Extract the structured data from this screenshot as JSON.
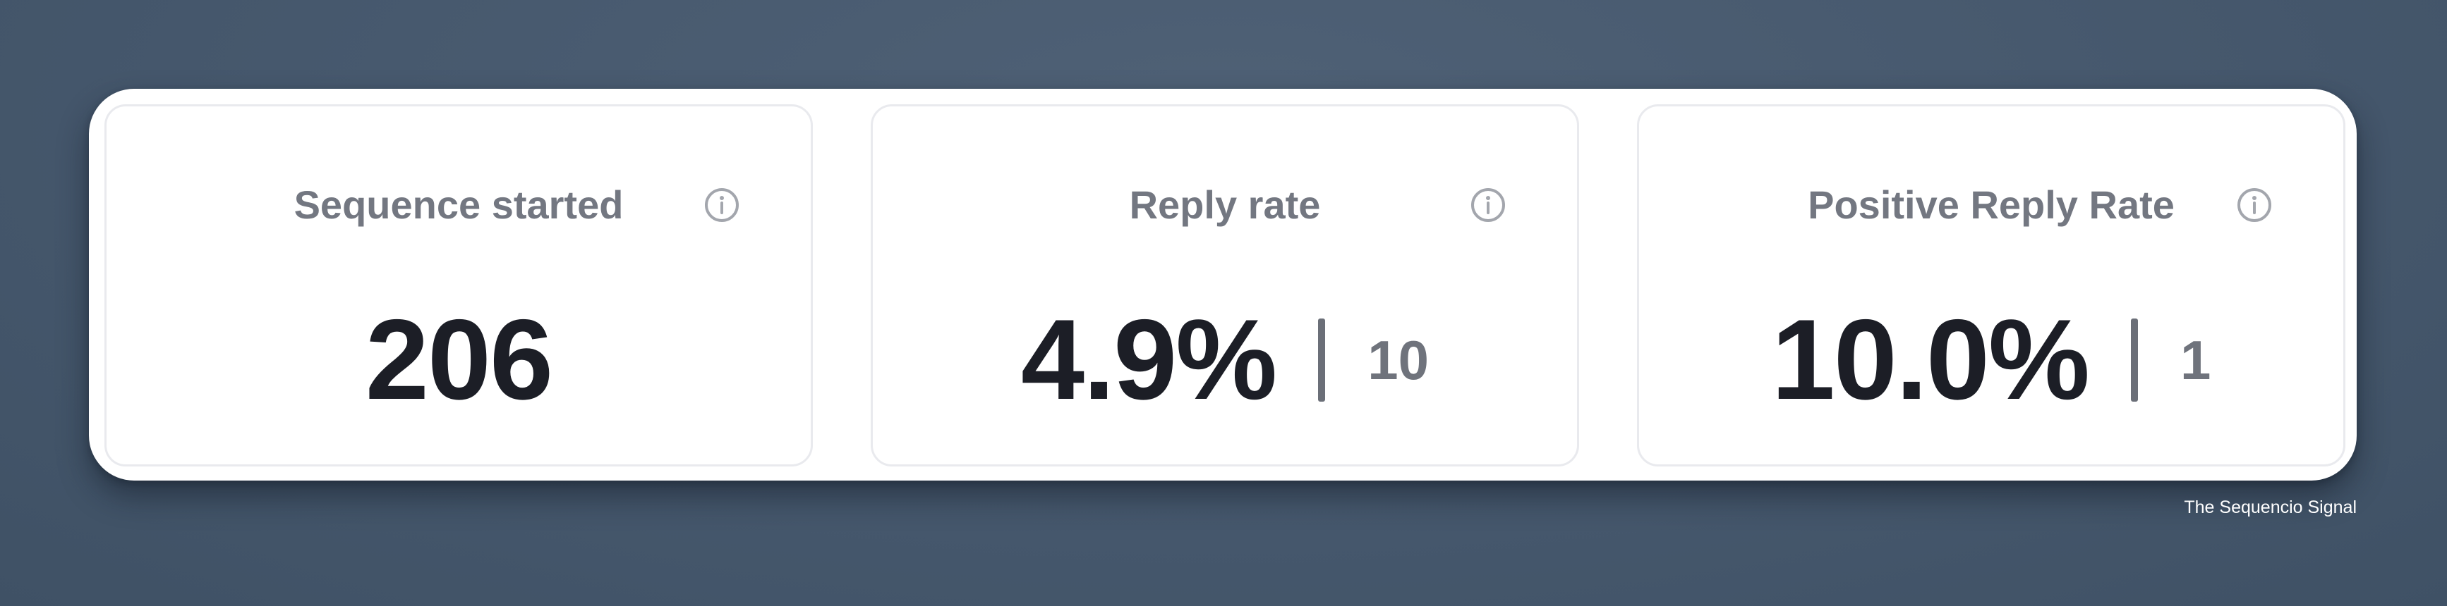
{
  "metrics": [
    {
      "title": "Sequence started",
      "value": "206",
      "icon": "info-icon"
    },
    {
      "title": "Reply rate",
      "value": "4.9%",
      "count": "10",
      "icon": "info-icon"
    },
    {
      "title": "Positive Reply Rate",
      "value": "10.0%",
      "count": "1",
      "icon": "info-icon"
    }
  ],
  "watermark": "The Sequencio Signal",
  "colors": {
    "background": "#46586d",
    "panel": "#ffffff",
    "card_border": "#e9eaee",
    "title_text": "#737781",
    "value_text": "#1c1e26",
    "count_text": "#6f737c",
    "icon_stroke": "#a3a6ad"
  }
}
